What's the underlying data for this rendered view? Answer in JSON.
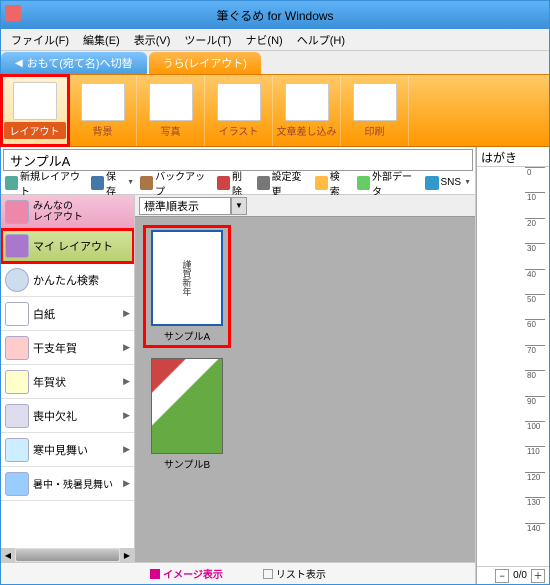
{
  "window": {
    "title": "筆ぐるめ for Windows"
  },
  "menu": {
    "file": "ファイル(F)",
    "edit": "編集(E)",
    "view": "表示(V)",
    "tool": "ツール(T)",
    "navi": "ナビ(N)",
    "help": "ヘルプ(H)"
  },
  "tabs": {
    "omote": "おもて(宛て名)へ切替",
    "ura": "うら(レイアウト)"
  },
  "ribbon": {
    "layout": "レイアウト",
    "background": "背景",
    "photo": "写真",
    "illust": "イラスト",
    "insert": "文章差し込み",
    "print": "印刷"
  },
  "current_layout_name": "サンプルA",
  "toolbar": {
    "new": "新規レイアウト",
    "save": "保存",
    "backup": "バックアップ",
    "delete": "削除",
    "settings": "設定変更",
    "search": "検 索",
    "extdata": "外部データ",
    "sns": "SNS"
  },
  "categories": [
    {
      "label": "みんなの\nレイアウト",
      "icon": "people-icon"
    },
    {
      "label": "マイ レイアウト",
      "icon": "user-icon"
    },
    {
      "label": "かんたん検索",
      "icon": "search-icon"
    },
    {
      "label": "白紙",
      "icon": "blank-icon"
    },
    {
      "label": "干支年賀",
      "icon": "eto-icon"
    },
    {
      "label": "年賀状",
      "icon": "nenga-icon"
    },
    {
      "label": "喪中欠礼",
      "icon": "mourning-icon"
    },
    {
      "label": "寒中見舞い",
      "icon": "winter-icon"
    },
    {
      "label": "暑中・残暑見舞い",
      "icon": "summer-icon"
    }
  ],
  "sort": {
    "label": "標準順表示"
  },
  "thumbs": [
    {
      "label": "サンプルA"
    },
    {
      "label": "サンプルB"
    }
  ],
  "viewmode": {
    "image": "イメージ表示",
    "list": "リスト表示"
  },
  "right": {
    "title": "はがき",
    "zoom": "0/0"
  },
  "ruler_ticks": [
    "0",
    "10",
    "20",
    "30",
    "40",
    "50",
    "60",
    "70",
    "80",
    "90",
    "100",
    "110",
    "120",
    "130",
    "140"
  ]
}
